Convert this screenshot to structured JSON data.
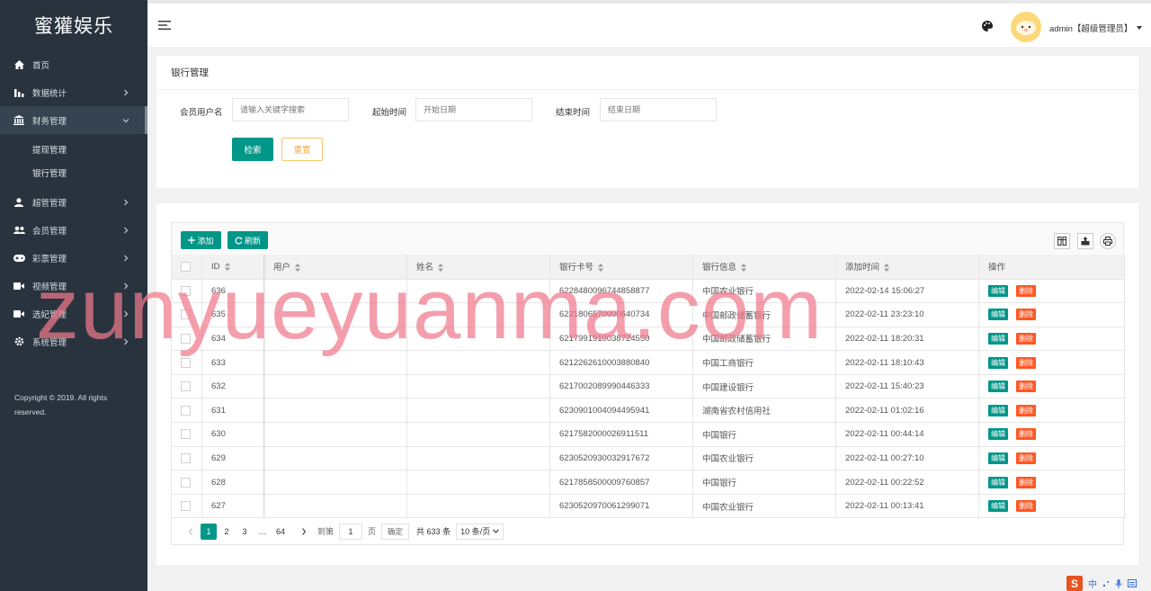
{
  "brand": "蜜獾娱乐",
  "sidebar": {
    "items": [
      {
        "label": "首页",
        "icon": "home-icon"
      },
      {
        "label": "数据统计",
        "icon": "bar-chart-icon"
      },
      {
        "label": "财务管理",
        "icon": "bank-icon",
        "expanded": true
      },
      {
        "label": "超管管理",
        "icon": "user-icon"
      },
      {
        "label": "会员管理",
        "icon": "users-icon"
      },
      {
        "label": "彩票管理",
        "icon": "gamepad-icon"
      },
      {
        "label": "视频管理",
        "icon": "video-icon"
      },
      {
        "label": "选妃管理",
        "icon": "video-icon"
      },
      {
        "label": "系统管理",
        "icon": "gear-icon"
      }
    ],
    "submenu": [
      {
        "label": "提现管理"
      },
      {
        "label": "银行管理"
      }
    ],
    "copyright": "Copyright © 2019. All rights reserved."
  },
  "header": {
    "user": "admin【超级管理员】"
  },
  "search": {
    "title": "银行管理",
    "member_label": "会员用户名",
    "member_placeholder": "请输入关键字搜索",
    "start_label": "起始时间",
    "start_placeholder": "开始日期",
    "end_label": "结束时间",
    "end_placeholder": "结束日期",
    "search_button": "检索",
    "reset_button": "重置"
  },
  "table": {
    "add_button": "添加",
    "refresh_button": "刷新",
    "columns": [
      "ID",
      "用户",
      "姓名",
      "银行卡号",
      "银行信息",
      "添加时间",
      "操作"
    ],
    "edit_label": "编辑",
    "delete_label": "删除",
    "rows": [
      {
        "id": "636",
        "user": "",
        "name": "",
        "card": "6228480096744858877",
        "bank": "中国农业银行",
        "time": "2022-02-14 15:06:27"
      },
      {
        "id": "635",
        "user": "",
        "name": "",
        "card": "6221806570000640734",
        "bank": "中国邮政储蓄银行",
        "time": "2022-02-11 23:23:10"
      },
      {
        "id": "634",
        "user": "",
        "name": "",
        "card": "6217991910038724550",
        "bank": "中国邮政储蓄银行",
        "time": "2022-02-11 18:20:31"
      },
      {
        "id": "633",
        "user": "",
        "name": "",
        "card": "6212262610003880840",
        "bank": "中国工商银行",
        "time": "2022-02-11 18:10:43"
      },
      {
        "id": "632",
        "user": "",
        "name": "",
        "card": "6217002089990446333",
        "bank": "中国建设银行",
        "time": "2022-02-11 15:40:23"
      },
      {
        "id": "631",
        "user": "",
        "name": "",
        "card": "6230901004094495941",
        "bank": "湖南省农村信用社",
        "time": "2022-02-11 01:02:16"
      },
      {
        "id": "630",
        "user": "",
        "name": "",
        "card": "6217582000026911511",
        "bank": "中国银行",
        "time": "2022-02-11 00:44:14"
      },
      {
        "id": "629",
        "user": "",
        "name": "",
        "card": "6230520930032917672",
        "bank": "中国农业银行",
        "time": "2022-02-11 00:27:10"
      },
      {
        "id": "628",
        "user": "",
        "name": "",
        "card": "6217858500009760857",
        "bank": "中国银行",
        "time": "2022-02-11 00:22:52"
      },
      {
        "id": "627",
        "user": "",
        "name": "",
        "card": "6230520970061299071",
        "bank": "中国农业银行",
        "time": "2022-02-11 00:13:41"
      }
    ]
  },
  "pager": {
    "pages": [
      "1",
      "2",
      "3",
      "…",
      "64"
    ],
    "goto_label": "到第",
    "goto_value": "1",
    "page_unit": "页",
    "confirm": "确定",
    "total": "共 633 条",
    "page_size": "10 条/页"
  },
  "watermark": "zunyueyuanma.com",
  "ime": {
    "lang": "中"
  },
  "colors": {
    "sidebar": "#28333e",
    "primary": "#009688",
    "danger": "#ff5722",
    "warning": "#f3a83b"
  }
}
